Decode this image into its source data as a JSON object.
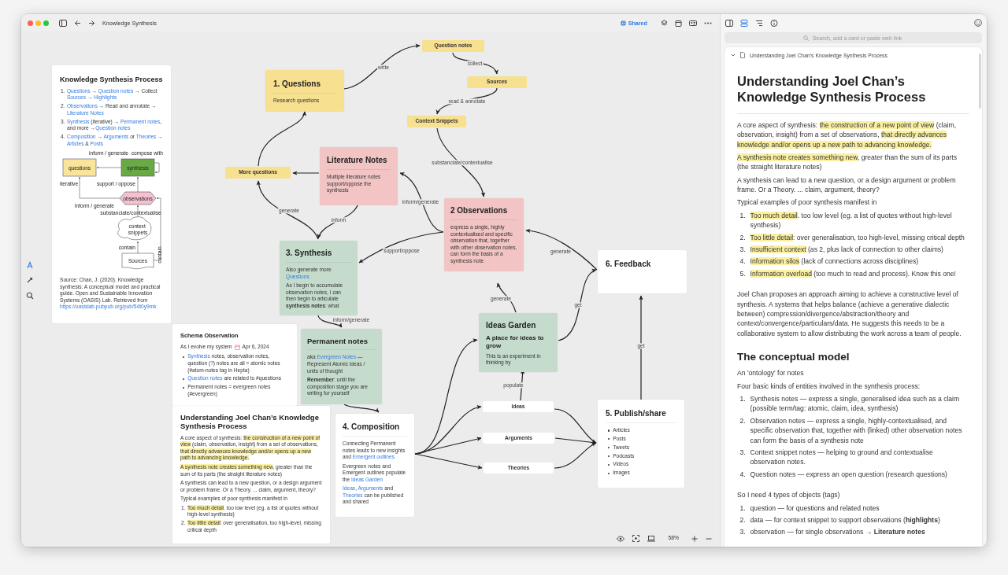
{
  "window": {
    "title": "Knowledge Synthesis",
    "share_label": "Shared"
  },
  "canvas_tools": [
    {
      "selected": true
    },
    {
      "selected": false
    },
    {
      "selected": false
    }
  ],
  "zoom_level": "58%",
  "cards": [
    {
      "kind": "note",
      "color": "#ffffff",
      "title": "Knowledge Synthesis Process",
      "body": [
        {
          "kind": "ol",
          "items": [
            {
              "num": "1.",
              "text": [
                {
                  "kind": "link",
                  "text": "Questions"
                },
                " → ",
                {
                  "kind": "link",
                  "text": "Question notes"
                },
                " → Collect ",
                {
                  "kind": "link",
                  "text": "Sources"
                },
                " → ",
                {
                  "kind": "link",
                  "text": "Highlights"
                }
              ]
            },
            {
              "num": "2.",
              "text": [
                {
                  "kind": "link",
                  "text": "Observations"
                },
                " → Read and annotate → ",
                {
                  "kind": "link",
                  "text": "Literature Notes"
                }
              ]
            },
            {
              "num": "3.",
              "text": [
                {
                  "kind": "link",
                  "text": "Synthesis"
                },
                " (iterative) → ",
                {
                  "kind": "link",
                  "text": "Permanent notes"
                },
                ", and more →",
                {
                  "kind": "link",
                  "text": "Question notes"
                }
              ]
            },
            {
              "num": "4.",
              "text": [
                {
                  "kind": "link",
                  "text": "Composition"
                },
                " → ",
                {
                  "kind": "link",
                  "text": "Arguments"
                },
                " or ",
                {
                  "kind": "link",
                  "text": "Theories"
                },
                " → ",
                {
                  "kind": "link",
                  "text": "Articles"
                },
                " & ",
                {
                  "kind": "link",
                  "text": "Posts"
                }
              ]
            }
          ]
        },
        {
          "kind": "diagram",
          "labels": [
            "inform / generate",
            "compose with",
            "questions",
            "synthesis",
            "iterative",
            "support / oppose",
            "observations",
            "inform / generate",
            "substanciate/contextualise",
            "context snippets",
            "contain",
            "contain",
            "Sources"
          ]
        },
        {
          "kind": "p",
          "text": [
            "Source: Chan, J. (2020). Knowledge synthesis: A conceptual model and practical guide. Open and Sustainable Innovation Systems (OASIS) Lab. Retrieved from ",
            {
              "kind": "link",
              "text": "https://oasislab.pubpub.org/pub/54t0y9mk"
            }
          ]
        }
      ]
    },
    {
      "kind": "note",
      "color": "#f7e08f",
      "title": "1. Questions",
      "body": [
        {
          "kind": "p",
          "text": [
            "Research questions"
          ]
        }
      ]
    },
    {
      "kind": "label",
      "color": "#f7e08f",
      "title": "Question notes"
    },
    {
      "kind": "label",
      "color": "#f7e08f",
      "title": "Sources"
    },
    {
      "kind": "label",
      "color": "#f7e08f",
      "title": "Context Snippets"
    },
    {
      "kind": "label",
      "color": "#f7e08f",
      "title": "More questions"
    },
    {
      "kind": "note",
      "color": "#f2c4c4",
      "title": "Literature Notes",
      "body": [
        {
          "kind": "p",
          "text": [
            "Multiple literature notes support/oppose the synthesis"
          ]
        }
      ]
    },
    {
      "kind": "note",
      "color": "#f2c4c4",
      "title": "2 Observations",
      "body": [
        {
          "kind": "p",
          "text": [
            "express a single, highly contextualised and specific observation that, together with other observation notes, can form the basis of a synthesis note"
          ]
        }
      ]
    },
    {
      "kind": "note",
      "color": "#c5dccd",
      "title": "3. Synthesis",
      "body": [
        {
          "kind": "p",
          "text": [
            "Also generate more ",
            {
              "kind": "link",
              "text": "Questions"
            }
          ]
        },
        {
          "kind": "p",
          "text": [
            "As I begin to accumulate observation notes, I can then begin to articulate **synthesis notes**: what"
          ]
        }
      ]
    },
    {
      "kind": "note",
      "color": "#ffffff",
      "title": "6. Feedback"
    },
    {
      "kind": "note",
      "color": "#ffffff",
      "title": "Schema Observation",
      "body": [
        {
          "kind": "meta",
          "text": "As I evolve my system",
          "date": "Apr 6, 2024"
        },
        {
          "kind": "ul",
          "items": [
            {
              "text": [
                {
                  "kind": "link",
                  "text": "Synthesis"
                },
                " notes, observation notes, question (?) notes are all = atomic notes (#atom-notes tag in Hepta)"
              ]
            },
            {
              "text": [
                {
                  "kind": "link",
                  "text": "Question notes"
                },
                " are related to #questions"
              ]
            },
            {
              "text": [
                "Permanent notes = evergreen notes (#evergreen)"
              ]
            }
          ]
        }
      ]
    },
    {
      "kind": "note",
      "color": "#c5dccd",
      "title": "Permanent notes",
      "body": [
        {
          "kind": "p",
          "text": [
            "aka ",
            {
              "kind": "link",
              "text": "Evergreen Notes"
            },
            " — Represent Atomic ideas / units of thought"
          ]
        },
        {
          "kind": "p",
          "text": [
            "**Remember**: until the composition stage you are writing for yourself"
          ]
        }
      ]
    },
    {
      "kind": "note",
      "color": "#c5dccd",
      "title": "Ideas Garden",
      "body": [
        {
          "kind": "h3",
          "text": "A place for ideas to grow"
        },
        {
          "kind": "p",
          "text": [
            "This is an experiment in thinking by"
          ]
        }
      ]
    },
    {
      "kind": "note",
      "color": "#ffffff",
      "title": "Understanding Joel Chan’s Knowledge Synthesis Process",
      "body": [
        {
          "kind": "p",
          "text": [
            "A core aspect of synthesis: ",
            {
              "kind": "mark",
              "text": "the construction of a new point of view"
            },
            " (claim, observation, insight) from a set of observations, ",
            {
              "kind": "mark",
              "text": "that directly advances knowledge and/or opens up a new path to advancing knowledge."
            }
          ]
        },
        {
          "kind": "p",
          "text": [
            {
              "kind": "mark",
              "text": "A synthesis note creates something new"
            },
            ", greater than the sum of its parts (the straight literature notes)"
          ]
        },
        {
          "kind": "p",
          "text": [
            "A synthesis can lead to a new question, or a design argument or problem frame. Or a Theory. ... claim, argument, theory?"
          ]
        },
        {
          "kind": "p",
          "text": [
            "Typical examples of poor synthesis manifest in"
          ]
        },
        {
          "kind": "ol",
          "items": [
            {
              "num": "1.",
              "text": [
                {
                  "kind": "mark",
                  "text": "Too much detail"
                },
                ". too low level (eg. a list of quotes without high-level synthesis)"
              ]
            },
            {
              "num": "2.",
              "text": [
                {
                  "kind": "mark",
                  "text": "Too little detail"
                },
                ": over generalisation, too high-level, missing critical depth"
              ]
            }
          ]
        }
      ]
    },
    {
      "kind": "note",
      "color": "#ffffff",
      "title": "4. Composition",
      "body": [
        {
          "kind": "p",
          "text": [
            "Connecting Permanent notes leads to new insights and ",
            {
              "kind": "link",
              "text": "Emergent outlines"
            }
          ]
        },
        {
          "kind": "p",
          "text": [
            "Evergreen notes and Emergent outlines  populate the ",
            {
              "kind": "link",
              "text": "Ideas Garden"
            }
          ]
        },
        {
          "kind": "p",
          "text": [
            {
              "kind": "link",
              "text": "Ideas"
            },
            ", ",
            {
              "kind": "link",
              "text": "Arguments"
            },
            " and ",
            {
              "kind": "link",
              "text": "Theories"
            },
            " can be published and shared"
          ]
        }
      ]
    },
    {
      "kind": "pill",
      "color": "#ffffff",
      "title": "Ideas"
    },
    {
      "kind": "pill",
      "color": "#ffffff",
      "title": "Arguments"
    },
    {
      "kind": "pill",
      "color": "#ffffff",
      "title": "Theories"
    },
    {
      "kind": "note",
      "color": "#ffffff",
      "title": "5. Publish/share",
      "body": [
        {
          "kind": "ul",
          "items": [
            {
              "text": [
                "Articles"
              ]
            },
            {
              "text": [
                "Posts"
              ]
            },
            {
              "text": [
                "Tweets"
              ]
            },
            {
              "text": [
                "Podcasts"
              ]
            },
            {
              "text": [
                "Videos"
              ]
            },
            {
              "text": [
                "Images"
              ]
            }
          ]
        }
      ]
    }
  ],
  "edges": [
    {
      "kind": "arrow",
      "label": "write"
    },
    {
      "kind": "arrow",
      "label": "collect"
    },
    {
      "kind": "arrow",
      "label": "read & annotate"
    },
    {
      "kind": "arrow",
      "label": "substanciate/contextualise"
    },
    {
      "kind": "arrow"
    },
    {
      "kind": "arrow"
    },
    {
      "kind": "arrow",
      "label": "generate"
    },
    {
      "kind": "arrow",
      "label": "inform"
    },
    {
      "kind": "arrow",
      "label": "inform/generate"
    },
    {
      "kind": "arrow",
      "label": "support/oppose"
    },
    {
      "kind": "arrow",
      "label": "generate"
    },
    {
      "kind": "arrow",
      "label": "get"
    },
    {
      "kind": "arrow",
      "label": "generate"
    },
    {
      "kind": "arrow",
      "label": "get"
    },
    {
      "kind": "arrow",
      "label": "inform/generate"
    },
    {
      "kind": "arrow"
    },
    {
      "kind": "arrow"
    },
    {
      "kind": "arrow"
    },
    {
      "kind": "arrow"
    },
    {
      "kind": "arrow"
    },
    {
      "kind": "arrow",
      "label": "populate"
    },
    {
      "kind": "arrow"
    },
    {
      "kind": "arrow"
    },
    {
      "kind": "arrow"
    }
  ],
  "side_panel": {
    "tabs": [
      {
        "selected": false
      },
      {
        "selected": true
      },
      {
        "selected": false
      },
      {
        "selected": false
      }
    ],
    "search": {
      "placeholder": "Search, add a card or paste web link"
    },
    "card_title": "Understanding Joel Chan’s Knowledge Synthesis Process",
    "expanded": true,
    "article": [
      {
        "kind": "h1",
        "text": "Understanding Joel Chan’s Knowledge Synthesis Process"
      },
      {
        "kind": "p",
        "text": [
          "A core aspect of synthesis: ",
          {
            "kind": "mark",
            "text": "the construction of a new point of view"
          },
          " (claim, observation, insight) from a set of observations, ",
          {
            "kind": "mark",
            "text": "that directly advances knowledge and/or opens up a new path to advancing knowledge."
          }
        ]
      },
      {
        "kind": "p",
        "text": [
          {
            "kind": "mark",
            "text": "A synthesis note creates something new"
          },
          ", greater than the sum of its parts (the straight literature notes)"
        ]
      },
      {
        "kind": "p",
        "text": [
          "A synthesis can lead to a new question, or a design argument or problem frame. Or a Theory. ... claim, argument, theory?"
        ]
      },
      {
        "kind": "p",
        "text": [
          "Typical examples of poor synthesis manifest in"
        ]
      },
      {
        "kind": "ol",
        "items": [
          {
            "num": "1.",
            "text": [
              {
                "kind": "mark",
                "text": "Too much detail"
              },
              ". too low level (eg. a list of quotes without high-level synthesis)"
            ]
          },
          {
            "num": "2.",
            "text": [
              {
                "kind": "mark",
                "text": "Too little detail"
              },
              ": over generalisation, too high-level, missing critical depth"
            ]
          },
          {
            "num": "3.",
            "text": [
              {
                "kind": "mark",
                "text": "Insufficient context"
              },
              " (as 2, plus lack of connection to other claims)"
            ]
          },
          {
            "num": "4.",
            "text": [
              {
                "kind": "mark",
                "text": "Information silos"
              },
              " (lack of connections across disciplines)"
            ]
          },
          {
            "num": "5.",
            "text": [
              {
                "kind": "mark",
                "text": "Information overload"
              },
              " (too much to read and process). Know this one!"
            ]
          }
        ]
      },
      {
        "kind": "p",
        "text": [
          "Joel Chan proposes an approach aiming to achieve a constructive level of synthesis. A systems that helps balance (achieve a generative dialectic between) compression/divergence/abstraction/theory and context/convergence/particulars/data. He suggests this needs to be a collaborative system to allow distributing the work across a team of people."
        ]
      },
      {
        "kind": "h2",
        "text": "The conceptual model"
      },
      {
        "kind": "p",
        "text": [
          "An 'ontology' for notes"
        ]
      },
      {
        "kind": "p",
        "text": [
          "Four basic kinds of entities involved in the synthesis process:"
        ]
      },
      {
        "kind": "ol",
        "items": [
          {
            "num": "1.",
            "text": [
              "Synthesis notes — express a single, generalised idea such as a claim (possible term/tag: atomic, claim, idea, synthesis)"
            ]
          },
          {
            "num": "2.",
            "text": [
              "Observation notes — express a single, highly-contextualised, and specific observation that, together with (linked) other observation notes can form the basis of a synthesis note"
            ]
          },
          {
            "num": "3.",
            "text": [
              "Context snippet notes — helping to ground and contextualise observation notes."
            ]
          },
          {
            "num": "4.",
            "text": [
              "Question notes — express an open question (research questions)"
            ]
          }
        ]
      },
      {
        "kind": "p",
        "text": [
          "So I need 4 types of objects (tags)"
        ]
      },
      {
        "kind": "ol",
        "items": [
          {
            "num": "1.",
            "text": [
              "question — for questions and related notes"
            ]
          },
          {
            "num": "2.",
            "text": [
              "data — for context snippet to support observations (**highlights**)"
            ]
          },
          {
            "num": "3.",
            "text": [
              "observation — for single observations → **Literature notes**"
            ]
          }
        ]
      }
    ]
  }
}
